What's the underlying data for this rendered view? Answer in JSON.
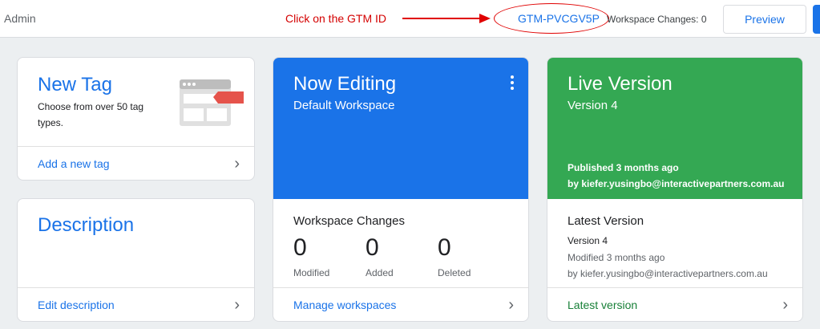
{
  "topbar": {
    "admin_label": "Admin",
    "annotation_text": "Click on the GTM ID",
    "container_id": "GTM-PVCGV5P",
    "workspace_changes_label": "Workspace Changes: 0",
    "preview_label": "Preview"
  },
  "colors": {
    "accent_blue": "#1a73e8",
    "live_green": "#34a853",
    "annotation_red": "#e00000",
    "tag_red": "#e5534b"
  },
  "new_tag": {
    "title": "New Tag",
    "description": "Choose from over 50 tag types.",
    "footer_link": "Add a new tag"
  },
  "description_card": {
    "title": "Description",
    "footer_link": "Edit description"
  },
  "now_editing": {
    "title": "Now Editing",
    "workspace": "Default Workspace",
    "changes_title": "Workspace Changes",
    "stats": [
      {
        "value": "0",
        "label": "Modified"
      },
      {
        "value": "0",
        "label": "Added"
      },
      {
        "value": "0",
        "label": "Deleted"
      }
    ],
    "footer_link": "Manage workspaces"
  },
  "live_version": {
    "title": "Live Version",
    "version": "Version 4",
    "published": "Published 3 months ago",
    "published_by": "by kiefer.yusingbo@interactivepartners.com.au",
    "latest_title": "Latest Version",
    "latest_version": "Version 4",
    "modified": "Modified 3 months ago",
    "modified_by": "by kiefer.yusingbo@interactivepartners.com.au",
    "footer_link": "Latest version"
  },
  "icons": {
    "chevron": "chevron-right-icon",
    "kebab": "more-vert-icon",
    "tag_illustration": "tag-illustration-icon"
  }
}
